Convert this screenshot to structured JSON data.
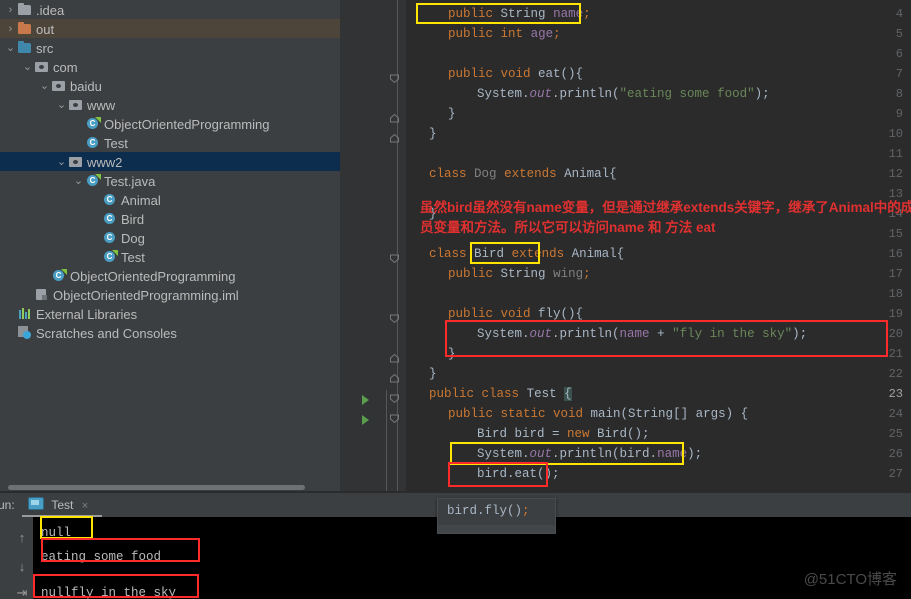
{
  "sidebar": {
    "items": [
      {
        "indent": 0,
        "arrow": "chevron-right",
        "icon": "folder-gray",
        "label": ".idea",
        "state": "normal"
      },
      {
        "indent": 0,
        "arrow": "chevron-right",
        "icon": "folder-orange",
        "label": "out",
        "state": "brown-highlight"
      },
      {
        "indent": 0,
        "arrow": "chevron-down",
        "icon": "folder-blue",
        "label": "src",
        "state": "normal"
      },
      {
        "indent": 1,
        "arrow": "chevron-down",
        "icon": "package",
        "label": "com",
        "state": "normal"
      },
      {
        "indent": 2,
        "arrow": "chevron-down",
        "icon": "package",
        "label": "baidu",
        "state": "normal"
      },
      {
        "indent": 3,
        "arrow": "chevron-down",
        "icon": "package",
        "label": "www",
        "state": "normal"
      },
      {
        "indent": 4,
        "arrow": "none",
        "icon": "java-class-runnable",
        "label": "ObjectOrientedProgramming",
        "state": "normal"
      },
      {
        "indent": 4,
        "arrow": "none",
        "icon": "java-class",
        "label": "Test",
        "state": "normal"
      },
      {
        "indent": 3,
        "arrow": "chevron-down",
        "icon": "package",
        "label": "www2",
        "state": "selected"
      },
      {
        "indent": 4,
        "arrow": "chevron-down",
        "icon": "java-class-runnable",
        "label": "Test.java",
        "state": "normal"
      },
      {
        "indent": 5,
        "arrow": "none",
        "icon": "java-class",
        "label": "Animal",
        "state": "normal"
      },
      {
        "indent": 5,
        "arrow": "none",
        "icon": "java-class",
        "label": "Bird",
        "state": "normal"
      },
      {
        "indent": 5,
        "arrow": "none",
        "icon": "java-class",
        "label": "Dog",
        "state": "normal"
      },
      {
        "indent": 5,
        "arrow": "none",
        "icon": "java-class-runnable",
        "label": "Test",
        "state": "normal"
      },
      {
        "indent": 2,
        "arrow": "none",
        "icon": "java-class-runnable",
        "label": "ObjectOrientedProgramming",
        "state": "normal"
      },
      {
        "indent": 1,
        "arrow": "none",
        "icon": "iml-file",
        "label": "ObjectOrientedProgramming.iml",
        "state": "normal"
      },
      {
        "indent": 0,
        "arrow": "none",
        "icon": "external-libraries",
        "label": "External Libraries",
        "state": "normal"
      },
      {
        "indent": 0,
        "arrow": "none",
        "icon": "scratches",
        "label": "Scratches and Consoles",
        "state": "normal"
      }
    ]
  },
  "editor": {
    "line_numbers": [
      "4",
      "5",
      "6",
      "7",
      "8",
      "9",
      "10",
      "11",
      "12",
      "13",
      "14",
      "15",
      "16",
      "17",
      "18",
      "19",
      "20",
      "21",
      "22",
      "23",
      "24",
      "25",
      "26",
      "27"
    ],
    "lines": {
      "l4_public": "public",
      "l4_string": "String",
      "l4_name": "name",
      "l4_semi": ";",
      "l5_public": "public",
      "l5_int": "int",
      "l5_age": "age",
      "l5_semi": ";",
      "l7": "public void eat(){",
      "l8_sys": "System.",
      "l8_out": "out",
      "l8_println": ".println(",
      "l8_str": "\"eating some food\"",
      "l8_end": ");",
      "l9": "}",
      "l10": "}",
      "l12_class": "class",
      "l12_dog": "Dog",
      "l12_extends": "extends",
      "l12_animal": "Animal{",
      "l14": "}",
      "l16_class": "class",
      "l16_bird": "Bird",
      "l16_extends": "extends",
      "l16_animal": "Animal{",
      "l17_public": "public",
      "l17_string": "String",
      "l17_wing": "wing",
      "l17_semi": ";",
      "l19": "public void fly(){",
      "l20_sys": "System.",
      "l20_out": "out",
      "l20_println": ".println(",
      "l20_name": "name",
      "l20_plus": " + ",
      "l20_str": "\"fly in the sky\"",
      "l20_end": ");",
      "l21": "}",
      "l22": "}",
      "l23_public": "public",
      "l23_class": "class",
      "l23_test": "Test ",
      "l23_brace": "{",
      "l24": "public static void main(String[] args) {",
      "l25_bird": "Bird bird = ",
      "l25_new": "new",
      "l25_ctor": " Bird();",
      "l26_sys": "System.",
      "l26_out": "out",
      "l26_println": ".println(",
      "l26_birdname": "bird.name",
      "l26_end": ");",
      "l27": "bird.eat();"
    },
    "annotation_note": {
      "line1": "虽然bird虽然没有name变量，但是通过继承extends关键字，继承了Animal中的成",
      "line2": "员变量和方法。所以它可以访问name 和  方法  eat"
    },
    "highlight_boxes": [
      {
        "name": "name-field-declaration",
        "color": "#ffe500"
      },
      {
        "name": "extends-keyword",
        "color": "#ffe500"
      },
      {
        "name": "fly-println-statement",
        "color": "#ff2b2b"
      },
      {
        "name": "bird-name-println",
        "color": "#ffe500"
      },
      {
        "name": "bird-eat-call",
        "color": "#ff2b2b"
      }
    ]
  },
  "tooltip": {
    "text": "bird.fly();"
  },
  "run_panel": {
    "label": "un:",
    "tab_name": "Test",
    "close_glyph": "×",
    "output": [
      {
        "text": "null",
        "box": "#ffe500"
      },
      {
        "text": "eating some food",
        "box": "#ff2b2b"
      },
      {
        "text": "nullfly in the sky",
        "box": "#ff2b2b"
      }
    ],
    "tools": {
      "up": "↑",
      "down": "↓",
      "wrap": "⇥"
    }
  },
  "watermark": {
    "text": "@51CTO博客"
  },
  "colors": {
    "keyword": "#cc7832",
    "string": "#6a8759",
    "field": "#9876aa",
    "default_text": "#a9b7c6",
    "editor_bg": "#2b2b2b",
    "panel_bg": "#3c3f41",
    "console_bg": "#000000",
    "annotation_red": "#e03030",
    "box_yellow": "#ffe500",
    "box_red": "#ff2b2b",
    "selection_blue": "#0d2d4f",
    "highlight_brown": "#4e453a"
  }
}
